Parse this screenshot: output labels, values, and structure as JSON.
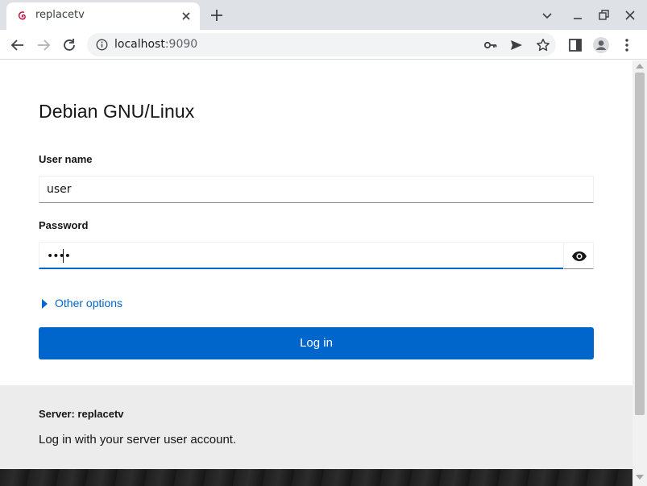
{
  "browser": {
    "tab_title": "replacetv",
    "url_host": "localhost",
    "url_port": ":9090",
    "accent": "#0066cc"
  },
  "login": {
    "brand": "Debian GNU/Linux",
    "username_label": "User name",
    "username_value": "user",
    "password_label": "Password",
    "password_value": "••••",
    "other_options": "Other options",
    "login_button": "Log in",
    "server": "Server: replacetv",
    "hint": "Log in with your server user account."
  }
}
